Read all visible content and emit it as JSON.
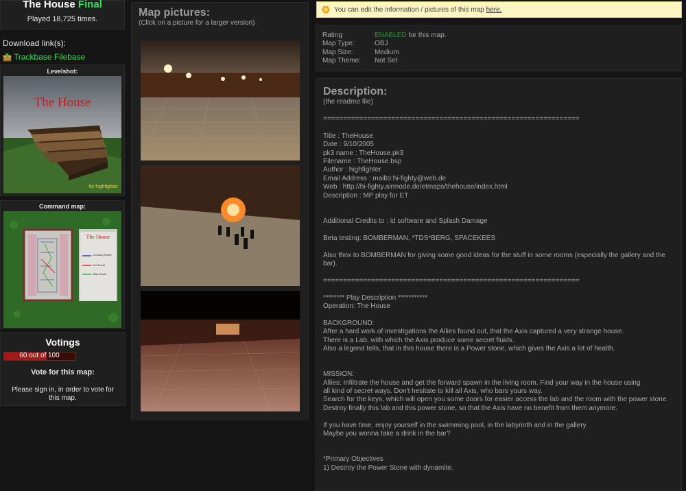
{
  "map": {
    "title": "The House",
    "title_suffix": "Final",
    "played": "Played 18,725 times.",
    "download_label": "Download link(s):",
    "download_link": "Trackbase Filebase",
    "levelshot_label": "Levelshot:",
    "levelshot_title": "The House",
    "levelshot_credit": "by highfighter",
    "command_map_label": "Command map:",
    "command_map_title": "The House",
    "command_map_legend": [
      "Crossing Route",
      "Exit Route",
      "Main Route"
    ]
  },
  "voting": {
    "title": "Votings",
    "score_text": "60 out of 100",
    "score": 60,
    "vote_title": "Vote for this map:",
    "vote_message": "Please sign in, in order to vote for this map."
  },
  "pictures": {
    "title": "Map pictures:",
    "subtitle": "(Click on a picture for a larger version)"
  },
  "notice": {
    "text": "You can edit the information / pictures of this map",
    "link": "here."
  },
  "info": {
    "rows": [
      {
        "key": "Rating",
        "value": "ENABLED",
        "suffix": "for this map."
      },
      {
        "key": "Map Type:",
        "value": "OBJ",
        "suffix": ""
      },
      {
        "key": "Map Size:",
        "value": "Medium",
        "suffix": ""
      },
      {
        "key": "Map Theme:",
        "value": "Not Set",
        "suffix": ""
      }
    ]
  },
  "description": {
    "title": "Description:",
    "subtitle": "(the readme file)",
    "text": "================================================================\n\nTitle : TheHouse\nDate : 9/10/2005\npk3 name : TheHouse.pk3\nFilename : TheHouse.bsp\nAuthor : highfighter\nEmail Address : mailto:hi-fighty@web.de\nWeb : http://hi-fighty.airmode.de/etmaps/thehouse/index.html\nDescription : MP play for ET\n\n\nAdditional Credits to : id software and Splash Damage\n\nBeta testing: BOMBERMAN, *TDS*BERG, SPACEKEES\n\nAlso thnx to BOMBERMAN for giving some good ideas for the stuff in some rooms (especially the gallery and the bar).\n\n================================================================\n\n******** Play Description ***********\nOperation: The House\n\nBACKGROUND:\nAfter a hard work of investigations the Allies found out, that the Axis captured a very strange house.\nThere is a Lab, with which the Axis produce some secret fluids.\nAlso a legend tells, that in this house there is a Power stone, which gives the Axis a lot of health.\n\n\nMISSION:\nAllies: Infiltrate the house and get the forward spawn in the living room. Find your way in the house using\nall kind of secret ways. Don't hesitate to kill all Axis, who bars yours way.\nSearch for the keys, which will open you some doors for easier access the lab and the room with the power stone.\nDestroy finally this lab and this power stone, so that the Axis have no benefit from them anymore.\n\nIf you have time, enjoy yourself in the swimming pool, in the labyrinth and in the gallery.\nMaybe you wonna take a drink in the bar?\n\n\n*Primary Objectives\n1) Destroy the Power Stone with dynamite."
  },
  "colors": {
    "final": "#35e35a",
    "link": "#2fe24f",
    "enabled": "#1e9a2e",
    "notice_bg": "#fcf6c3"
  }
}
